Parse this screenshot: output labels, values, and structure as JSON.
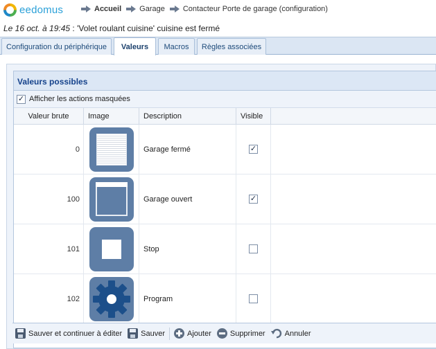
{
  "header": {
    "logo_text": "eedomus",
    "breadcrumbs": [
      "Accueil",
      "Garage",
      "Contacteur Porte de garage (configuration)"
    ]
  },
  "status": {
    "date": "Le 16 oct. à 19:45",
    "message": " : 'Volet roulant cuisine' cuisine est fermé"
  },
  "tabs": [
    {
      "label": "Configuration du périphérique",
      "active": false
    },
    {
      "label": "Valeurs",
      "active": true
    },
    {
      "label": "Macros",
      "active": false
    },
    {
      "label": "Règles associées",
      "active": false
    }
  ],
  "panel": {
    "title": "Valeurs possibles",
    "show_hidden_label": "Afficher les actions masquées",
    "show_hidden_checked": true,
    "columns": {
      "raw": "Valeur brute",
      "image": "Image",
      "description": "Description",
      "visible": "Visible"
    },
    "rows": [
      {
        "raw": "0",
        "image": "shutter-closed-icon",
        "description": "Garage fermé",
        "visible": true
      },
      {
        "raw": "100",
        "image": "shutter-open-icon",
        "description": "Garage ouvert",
        "visible": true
      },
      {
        "raw": "101",
        "image": "stop-icon",
        "description": "Stop",
        "visible": false
      },
      {
        "raw": "102",
        "image": "gear-icon",
        "description": "Program",
        "visible": false
      }
    ]
  },
  "toolbar": {
    "save_continue": "Sauver et continuer à éditer",
    "save": "Sauver",
    "add": "Ajouter",
    "delete": "Supprimer",
    "cancel": "Annuler"
  },
  "colors": {
    "accent": "#15428b",
    "tile": "#5e7ea6",
    "tab_bar": "#dbe6f3"
  }
}
